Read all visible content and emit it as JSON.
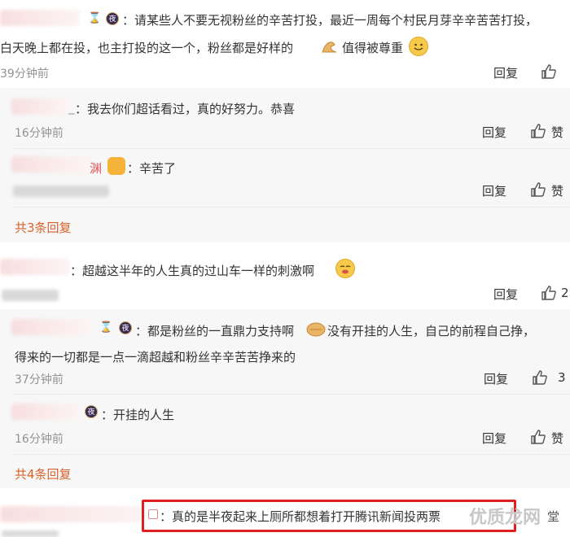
{
  "comments": [
    {
      "id": "c1",
      "name": "",
      "text": "：请某些人不要无视粉丝的辛苦打投，最近一周每个村民月芽辛辛苦苦打投，",
      "text2": "白天晚上都在投，也主打投的这一个，粉丝都是好样的",
      "text2b": "值得被尊重",
      "time": "39分钟前",
      "reply": "回复",
      "like": ""
    },
    {
      "id": "r1",
      "name": "_",
      "text": "：我去你们超话看过，真的好努力。恭喜",
      "time": "16分钟前",
      "reply": "回复",
      "like": "赞"
    },
    {
      "id": "r2",
      "name": "渊",
      "text": "：辛苦了",
      "time": "",
      "reply": "回复",
      "like": "赞"
    },
    {
      "id": "c2",
      "name": "",
      "text": "：超越这半年的人生真的过山车一样的刺激啊",
      "time": "",
      "reply": "回复",
      "like": "2"
    },
    {
      "id": "r3",
      "name": "",
      "text": "：都是粉丝的一直鼎力支持啊",
      "text_b": "没有开挂的人生，自己的前程自己挣，",
      "text2": "得来的一切都是一点一滴超越和粉丝辛辛苦苦挣来的",
      "time": "37分钟前",
      "reply": "回复",
      "like": "3"
    },
    {
      "id": "r4",
      "name": "",
      "text": "：开挂的人生",
      "time": "16分钟前",
      "reply": "回复",
      "like": "赞"
    },
    {
      "id": "c3",
      "name": "",
      "text": "：真的是半夜起来上厕所都想着打开腾讯新闻投两票",
      "time": "",
      "reply": "",
      "like": ""
    }
  ],
  "more1": "共3条回复",
  "more2": "共4条回复",
  "badge_char": "夜",
  "watermark": "优质龙网",
  "watermark2": "堂"
}
